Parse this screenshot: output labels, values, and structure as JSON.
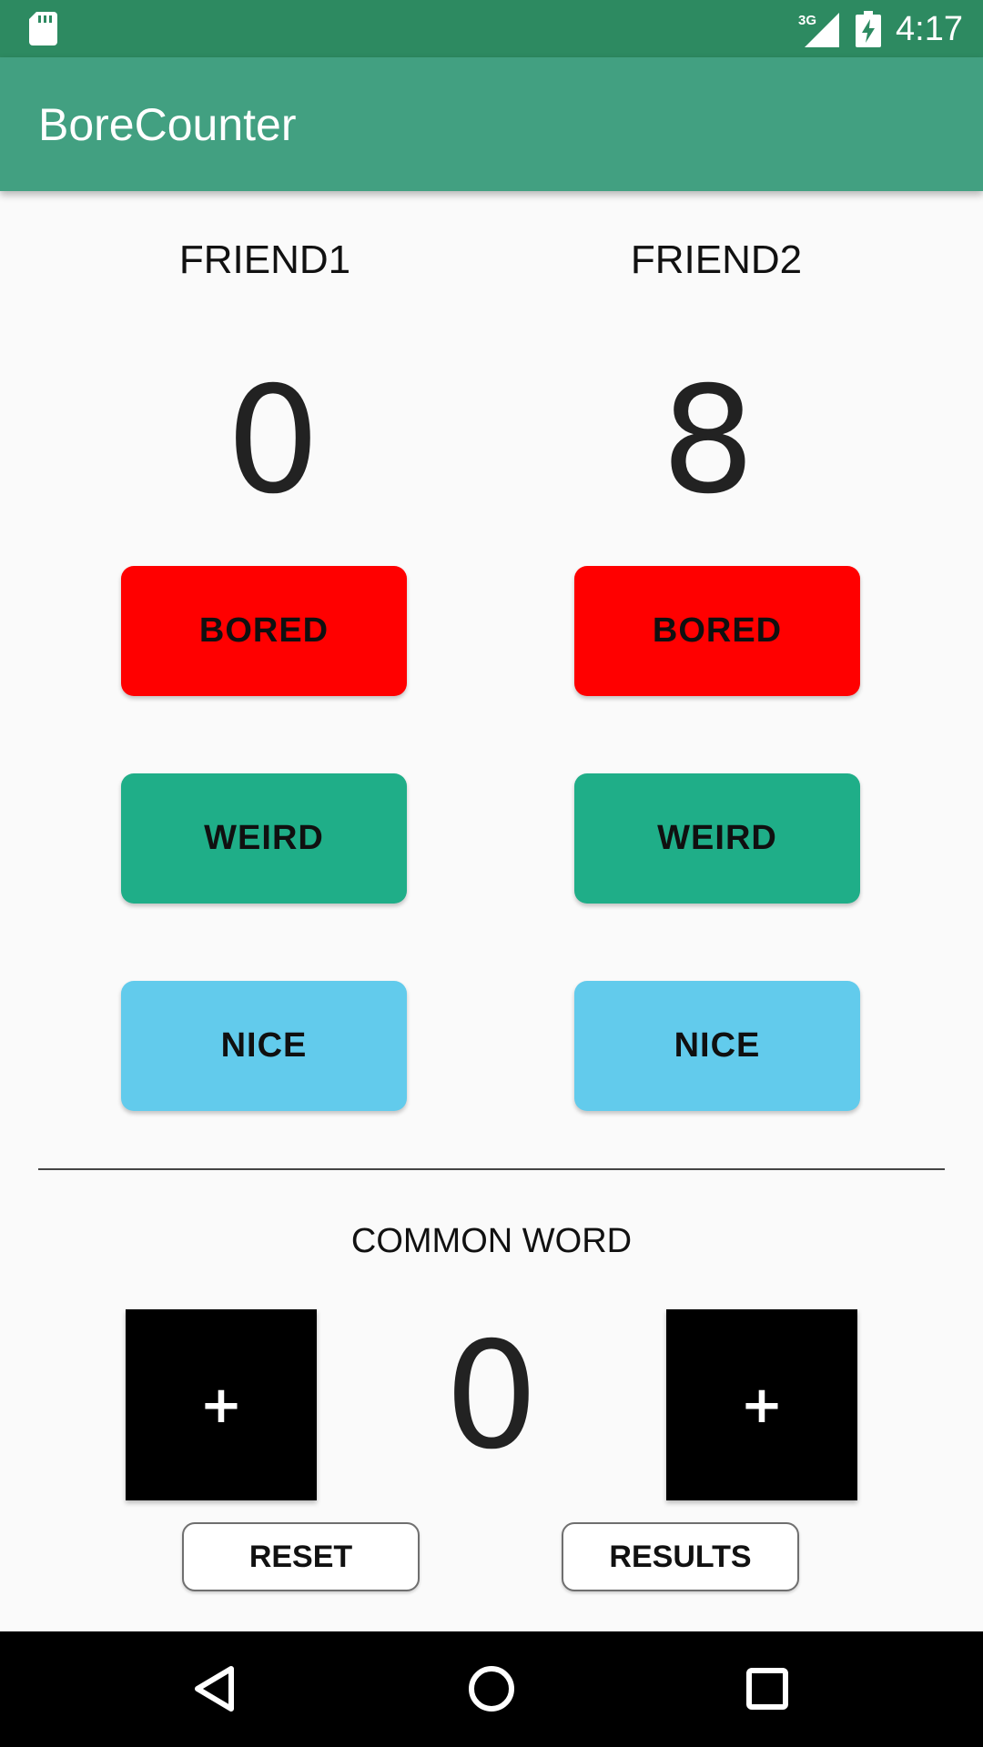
{
  "status_bar": {
    "network": "3G",
    "time": "4:17",
    "icons": [
      "sd-card-icon",
      "signal-icon",
      "battery-charging-icon"
    ]
  },
  "app_bar": {
    "title": "BoreCounter"
  },
  "friends": [
    {
      "name": "FRIEND1",
      "score": "0"
    },
    {
      "name": "FRIEND2",
      "score": "8"
    }
  ],
  "buttons": {
    "bored": "BORED",
    "weird": "WEIRD",
    "nice": "NICE"
  },
  "common": {
    "label": "COMMON WORD",
    "score": "0",
    "plus_label": "+"
  },
  "actions": {
    "reset": "RESET",
    "results": "RESULTS"
  },
  "navigation": {
    "icons": [
      "back-icon",
      "home-icon",
      "recents-icon"
    ]
  },
  "colors": {
    "status_bar": "#2d8a61",
    "app_bar": "#42a081",
    "bored": "#ff0000",
    "weird": "#1fae88",
    "nice": "#62cbec",
    "plus": "#000000"
  }
}
